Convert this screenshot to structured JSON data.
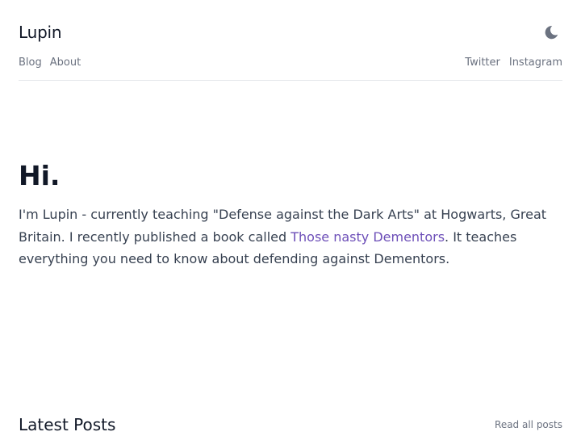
{
  "header": {
    "site_title": "Lupin",
    "theme_toggle_icon": "moon-icon"
  },
  "nav": {
    "left": [
      {
        "label": "Blog"
      },
      {
        "label": "About"
      }
    ],
    "right": [
      {
        "label": "Twitter"
      },
      {
        "label": "Instagram"
      }
    ]
  },
  "hero": {
    "title": "Hi.",
    "text_before_link": "I'm Lupin - currently teaching \"Defense against the Dark Arts\" at Hogwarts, Great Britain. I recently published a book called ",
    "link_text": "Those nasty Dementors",
    "text_after_link": ". It teaches everything you need to know about defending against Dementors."
  },
  "latest": {
    "title": "Latest Posts",
    "read_all_label": "Read all posts"
  },
  "colors": {
    "link_accent": "#6d4fb8",
    "muted_text": "#6b7280",
    "divider": "#e5e7eb"
  }
}
